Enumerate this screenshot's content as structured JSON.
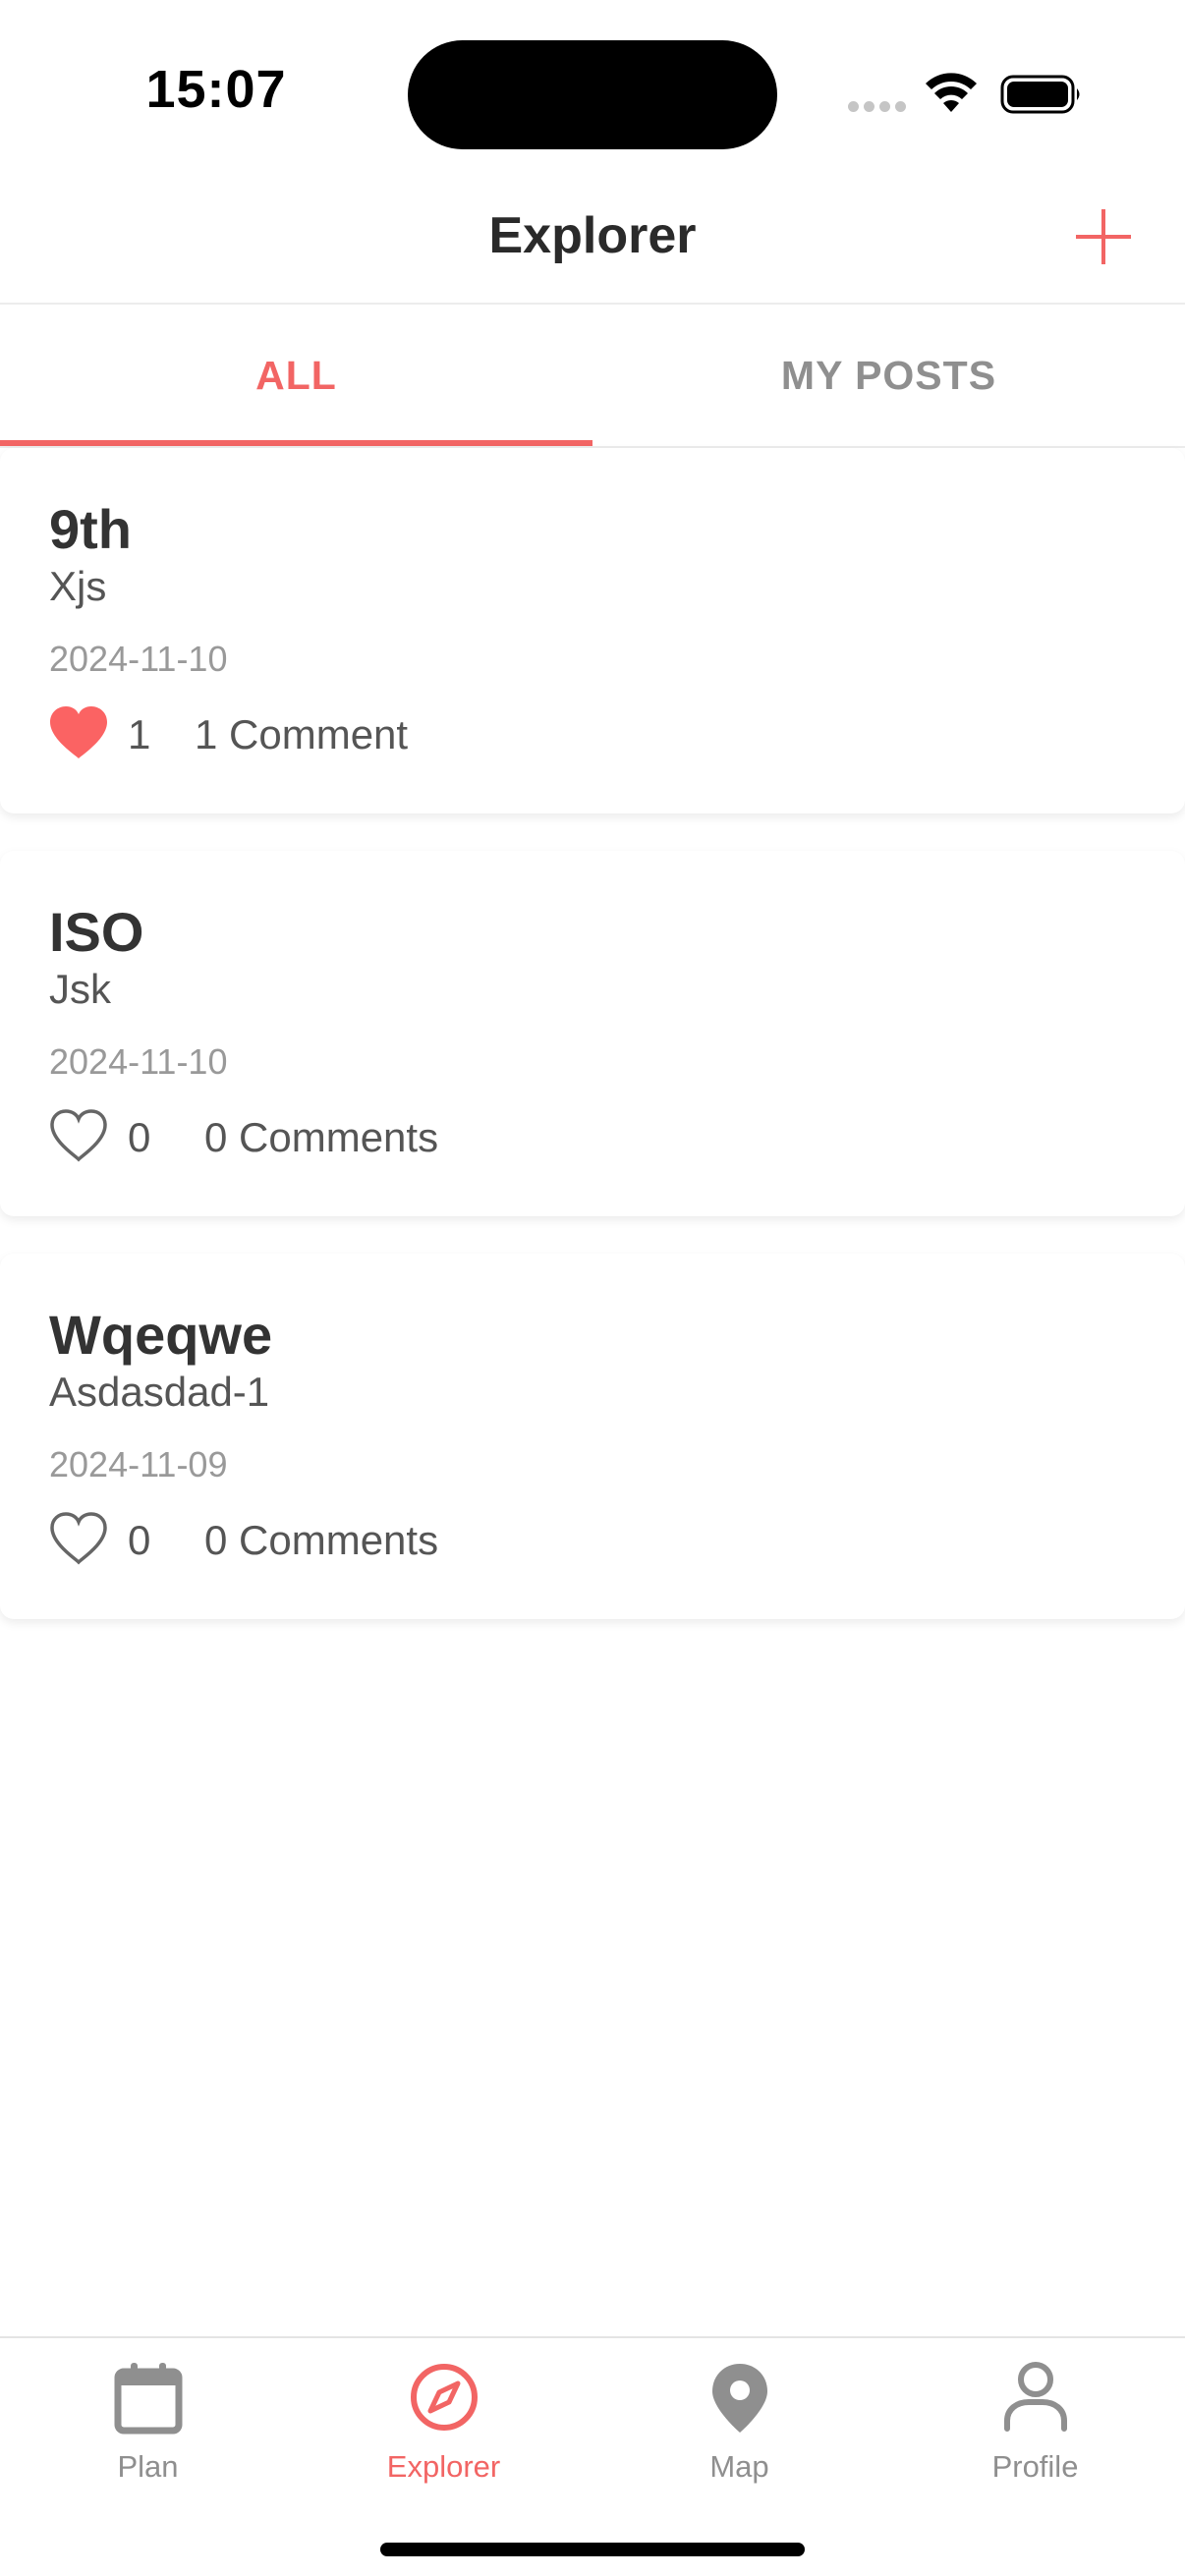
{
  "status": {
    "time": "15:07"
  },
  "header": {
    "title": "Explorer"
  },
  "tabs": [
    {
      "label": "ALL",
      "active": true
    },
    {
      "label": "MY POSTS",
      "active": false
    }
  ],
  "posts": [
    {
      "title": "9th",
      "subtitle": "Xjs",
      "date": "2024-11-10",
      "likes": "1",
      "liked": true,
      "comments": "1 Comment"
    },
    {
      "title": "ISO",
      "subtitle": "Jsk",
      "date": "2024-11-10",
      "likes": "0",
      "liked": false,
      "comments": "0 Comments"
    },
    {
      "title": "Wqeqwe",
      "subtitle": "Asdasdad-1",
      "date": "2024-11-09",
      "likes": "0",
      "liked": false,
      "comments": "0 Comments"
    }
  ],
  "tabbar": [
    {
      "label": "Plan",
      "icon": "calendar-icon",
      "active": false
    },
    {
      "label": "Explorer",
      "icon": "compass-icon",
      "active": true
    },
    {
      "label": "Map",
      "icon": "map-pin-icon",
      "active": false
    },
    {
      "label": "Profile",
      "icon": "person-icon",
      "active": false
    }
  ],
  "colors": {
    "accent": "#f26564",
    "muted": "#8f8f8f",
    "text": "#333333"
  }
}
